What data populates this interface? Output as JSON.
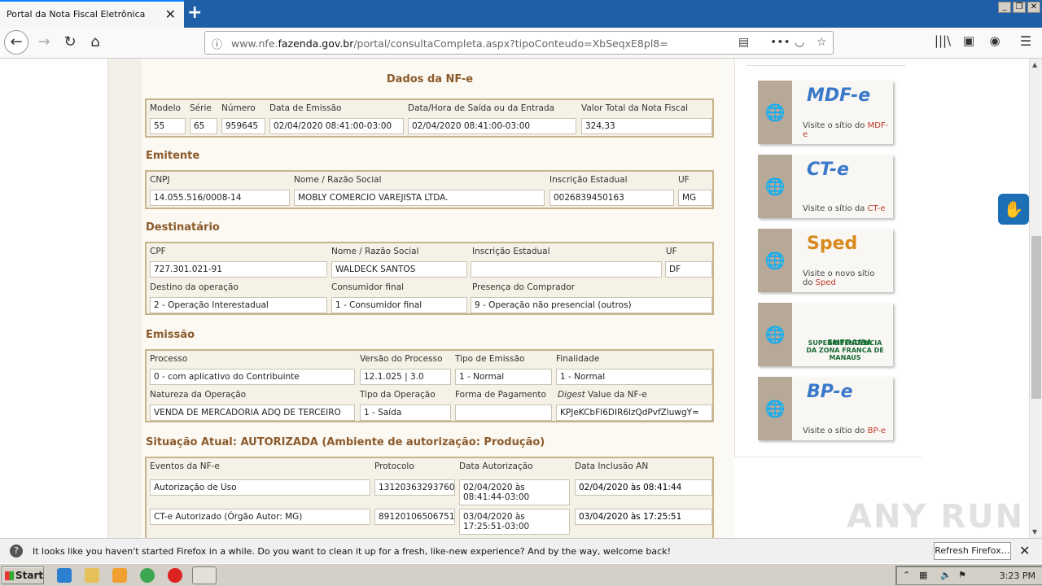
{
  "browser": {
    "tab_title": "Portal da Nota Fiscal Eletrônica",
    "url_prefix": "www.nfe.",
    "url_domain": "fazenda.gov.br",
    "url_suffix": "/portal/consultaCompleta.aspx?tipoConteudo=XbSeqxE8pl8="
  },
  "dados": {
    "heading": "Dados da NF-e",
    "modelo_label": "Modelo",
    "modelo": "55",
    "serie_label": "Série",
    "serie": "65",
    "numero_label": "Número",
    "numero": "959645",
    "emissao_label": "Data de Emissão",
    "emissao": "02/04/2020 08:41:00-03:00",
    "saida_label": "Data/Hora de Saída ou da Entrada",
    "saida": "02/04/2020 08:41:00-03:00",
    "valor_label": "Valor Total da Nota Fiscal",
    "valor": "324,33"
  },
  "emitente": {
    "heading": "Emitente",
    "cnpj_label": "CNPJ",
    "cnpj": "14.055.516/0008-14",
    "nome_label": "Nome / Razão Social",
    "nome": "MOBLY COMERCIO VAREJISTA LTDA.",
    "ie_label": "Inscrição Estadual",
    "ie": "0026839450163",
    "uf_label": "UF",
    "uf": "MG"
  },
  "destinatario": {
    "heading": "Destinatário",
    "cpf_label": "CPF",
    "cpf": "727.301.021-91",
    "nome_label": "Nome / Razão Social",
    "nome": "WALDECK SANTOS",
    "ie_label": "Inscrição Estadual",
    "ie": "",
    "uf_label": "UF",
    "uf": "DF",
    "destino_label": "Destino da operação",
    "destino": "2 - Operação Interestadual",
    "consumidor_label": "Consumidor final",
    "consumidor": "1 - Consumidor final",
    "presenca_label": "Presença do Comprador",
    "presenca": "9 - Operação não presencial (outros)"
  },
  "emissao": {
    "heading": "Emissão",
    "processo_label": "Processo",
    "processo": "0 - com aplicativo do Contribuinte",
    "versao_label": "Versão do Processo",
    "versao": "12.1.025 | 3.0",
    "tipo_label": "Tipo de Emissão",
    "tipo": "1 - Normal",
    "finalidade_label": "Finalidade",
    "finalidade": "1 - Normal",
    "natureza_label": "Natureza da Operação",
    "natureza": "VENDA DE MERCADORIA ADQ DE TERCEIRO",
    "tipo_op_label": "Tipo da Operação",
    "tipo_op": "1 - Saída",
    "forma_label": "Forma de Pagamento",
    "forma": "",
    "digest_label_em": "Digest",
    "digest_label_rest": " Value da NF-e",
    "digest": "KPJeKCbFI6DIR6lzQdPvfZluwgY="
  },
  "situacao": {
    "heading": "Situação Atual: AUTORIZADA (Ambiente de autorização: Produção)",
    "col_eventos": "Eventos da NF-e",
    "col_protocolo": "Protocolo",
    "col_data_aut": "Data Autorização",
    "col_data_incl": "Data Inclusão AN",
    "rows": [
      {
        "evento": "Autorização de Uso",
        "protocolo": "131203632937608",
        "data_aut_1": "02/04/2020 às",
        "data_aut_2": "08:41:44-03:00",
        "data_incl": "02/04/2020 às 08:41:44"
      },
      {
        "evento": "CT-e Autorizado (Órgão Autor: MG)",
        "protocolo": "891201065067519",
        "data_aut_1": "03/04/2020 às",
        "data_aut_2": "17:25:51-03:00",
        "data_incl": "03/04/2020 às 17:25:51"
      }
    ]
  },
  "sidebar": {
    "cards": [
      {
        "logo": "MDF-e",
        "cap_pre": "Visite o sítio do ",
        "cap_link": "MDF-e"
      },
      {
        "logo": "CT-e",
        "cap_pre": "Visite o sítio da ",
        "cap_link": "CT-e"
      },
      {
        "logo": "Sped",
        "cap_pre": "Visite o novo sítio do ",
        "cap_link": "Sped"
      },
      {
        "logo": "SUFRAMA",
        "cap_pre": "SUPERINTENDÊNCIA DA ZONA FRANCA DE MANAUS",
        "cap_link": ""
      },
      {
        "logo": "BP-e",
        "cap_pre": "Visite o sítio do ",
        "cap_link": "BP-e"
      }
    ]
  },
  "notification": {
    "message": "It looks like you haven't started Firefox in a while. Do you want to clean it up for a fresh, like-new experience? And by the way, welcome back!",
    "button": "Refresh Firefox…"
  },
  "taskbar": {
    "start": "Start",
    "clock": "3:23 PM"
  },
  "watermark": "ANY RUN"
}
